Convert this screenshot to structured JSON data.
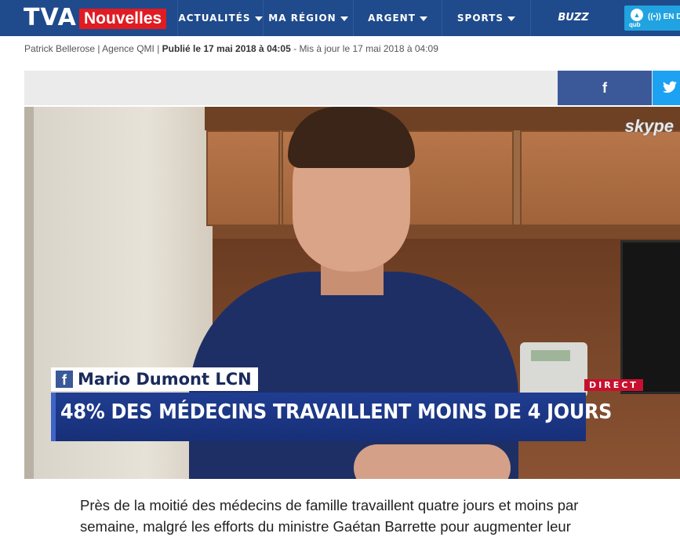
{
  "nav": {
    "logo_tva": "TVA",
    "logo_nouvelles": "Nouvelles",
    "items": [
      {
        "label": "ACTUALITÉS"
      },
      {
        "label": "MA RÉGION"
      },
      {
        "label": "ARGENT"
      },
      {
        "label": "SPORTS"
      },
      {
        "label": "BUZZ"
      }
    ],
    "qub_small": "qub",
    "qub_live": "EN DI"
  },
  "byline": {
    "author": "Patrick Bellerose | Agence QMI |",
    "published": "Publié le 17 mai 2018 à 04:05",
    "updated": "- Mis à jour le 17 mai 2018 à 04:09"
  },
  "share": {
    "facebook": "f"
  },
  "video": {
    "watermark": "skype",
    "lower_third_icon": "f",
    "speaker": "Mario Dumont LCN",
    "headline": "48% DES MÉDECINS TRAVAILLENT MOINS DE 4 JOURS",
    "badge": "DIRECT"
  },
  "article": {
    "lead": "Près de la moitié des médecins de famille travaillent quatre jours et moins par semaine, malgré les efforts du ministre Gaétan Barrette pour augmenter leur"
  },
  "colors": {
    "nav_bg": "#1f4a8c",
    "brand_red": "#e11b22",
    "facebook": "#3b5998",
    "twitter": "#1da1f2",
    "lcn_blue": "#203d91",
    "direct_red": "#c8102e"
  }
}
